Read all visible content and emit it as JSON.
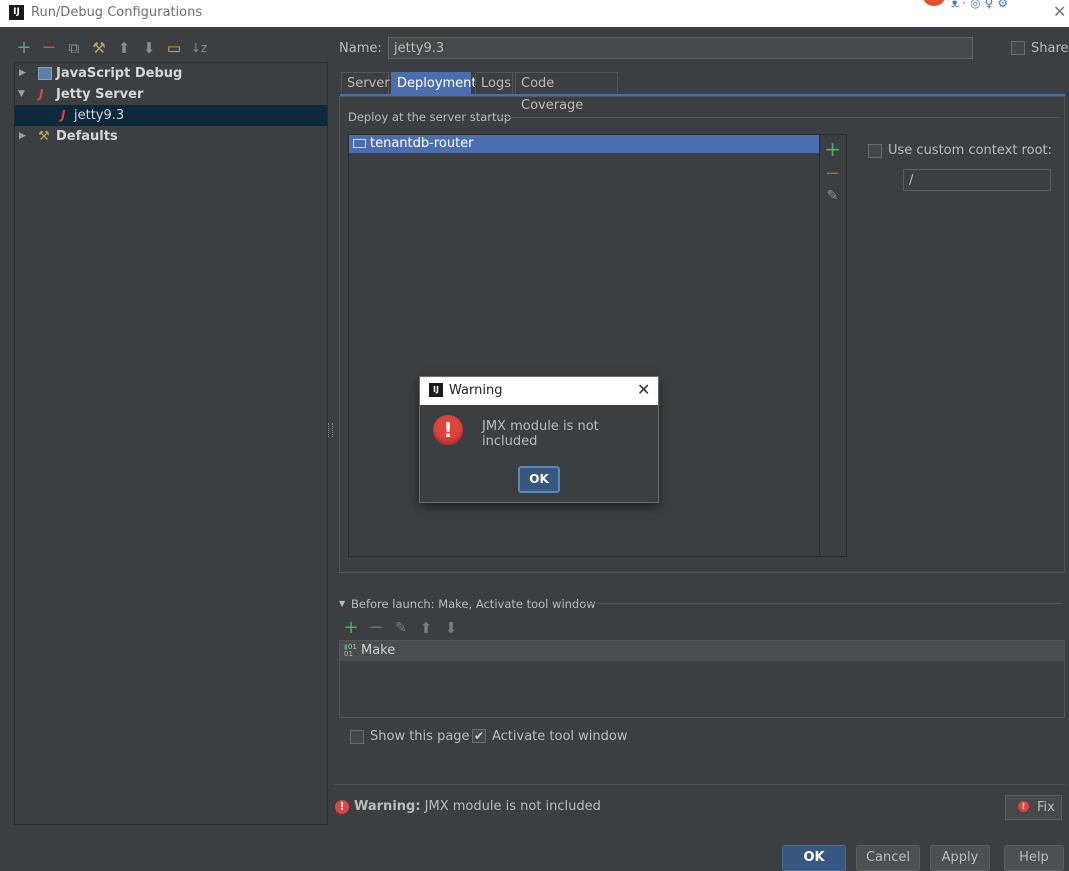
{
  "window": {
    "title": "Run/Debug Configurations"
  },
  "toolbar": {
    "icons": [
      "add-icon",
      "remove-icon",
      "copy-icon",
      "wrench-icon",
      "move-up-icon",
      "move-down-icon",
      "folder-icon",
      "sort-icon"
    ]
  },
  "tree": {
    "items": [
      {
        "label": "JavaScript Debug",
        "expanded": false
      },
      {
        "label": "Jetty Server",
        "expanded": true
      },
      {
        "label": "jetty9.3",
        "selected": true
      },
      {
        "label": "Defaults",
        "expanded": false
      }
    ]
  },
  "name": {
    "label": "Name:",
    "value": "jetty9.3"
  },
  "share": {
    "label": "Share",
    "checked": false
  },
  "tabs": [
    {
      "label": "Server"
    },
    {
      "label": "Deployment",
      "active": true
    },
    {
      "label": "Logs"
    },
    {
      "label": "Code Coverage"
    }
  ],
  "deployment": {
    "caption": "Deploy at the server startup",
    "items": [
      "tenantdb-router"
    ],
    "custom_root_label": "Use custom context root:",
    "custom_root_value": "/"
  },
  "before_launch": {
    "title": "Before launch: Make, Activate tool window",
    "items": [
      "Make"
    ]
  },
  "options": {
    "show_page_label": "Show this page",
    "show_page_checked": false,
    "activate_label": "Activate tool window",
    "activate_checked": true,
    "check_glyph": "✔"
  },
  "status": {
    "prefix": "Warning:",
    "message": "JMX module is not included",
    "fix_label": "Fix"
  },
  "buttons": {
    "ok": "OK",
    "cancel": "Cancel",
    "apply": "Apply",
    "help": "Help"
  },
  "dialog": {
    "title": "Warning",
    "message": "JMX module is not included",
    "ok": "OK"
  },
  "colors": {
    "accent": "#4b6eaf",
    "background": "#3c3f41",
    "error": "#e0443e",
    "add": "#59a869",
    "remove": "#c75450"
  }
}
